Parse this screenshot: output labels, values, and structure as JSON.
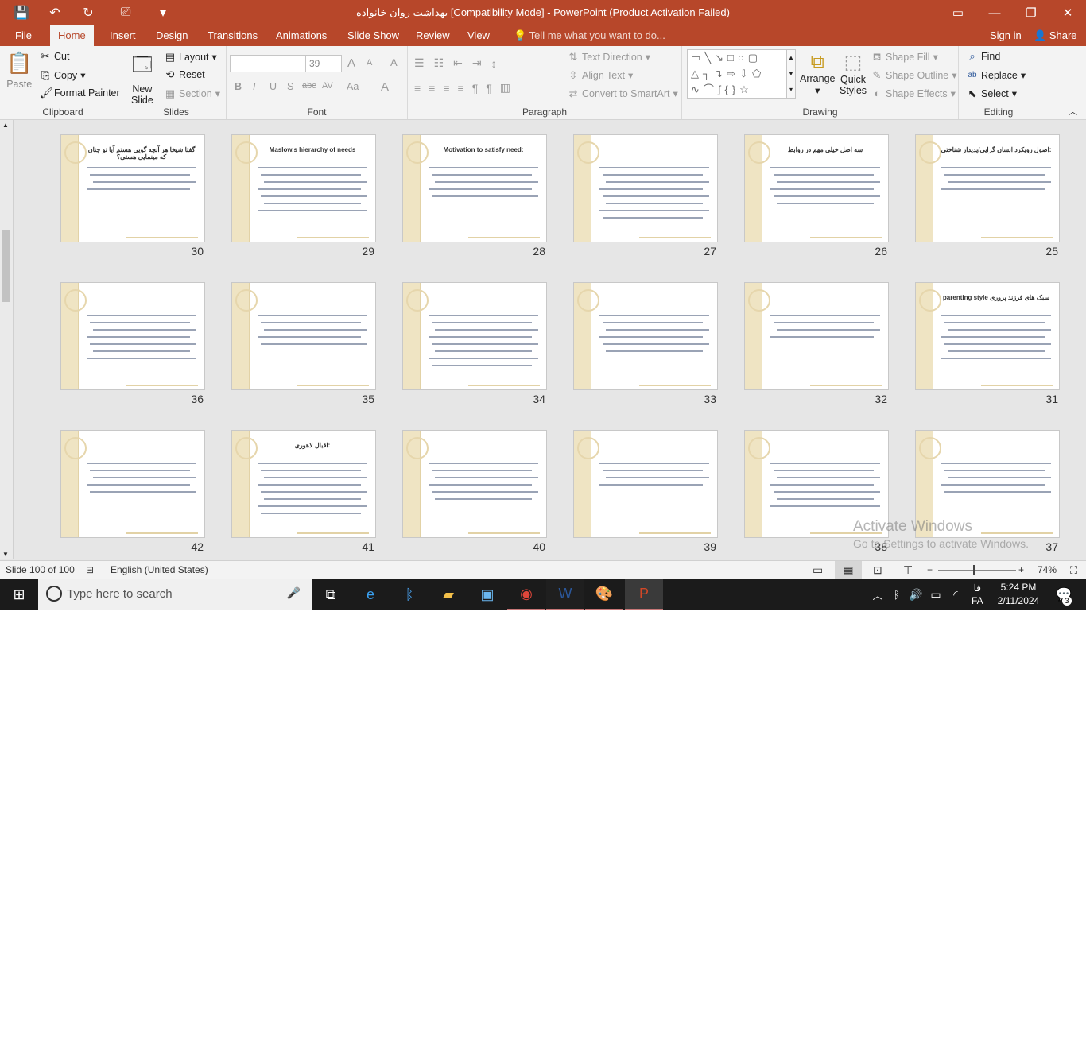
{
  "window": {
    "title": "بهداشت روان خانواده [Compatibility Mode] - PowerPoint (Product Activation Failed)",
    "controls": {
      "ribbon_display": "▭",
      "minimize": "—",
      "restore": "❐",
      "close": "✕"
    }
  },
  "qat": {
    "save": "💾",
    "undo": "↶",
    "redo": "↻",
    "present": "⎚",
    "customize": "▾"
  },
  "tabs": [
    "File",
    "Home",
    "Insert",
    "Design",
    "Transitions",
    "Animations",
    "Slide Show",
    "Review",
    "View"
  ],
  "tell_me": "Tell me what you want to do...",
  "sign_in": "Sign in",
  "share": "Share",
  "ribbon": {
    "clipboard": {
      "paste": "Paste",
      "cut": "Cut",
      "copy": "Copy",
      "format_painter": "Format Painter",
      "label": "Clipboard"
    },
    "slides": {
      "new_slide_1": "New",
      "new_slide_2": "Slide",
      "layout": "Layout",
      "reset": "Reset",
      "section": "Section",
      "label": "Slides"
    },
    "font": {
      "size": "39",
      "label": "Font",
      "bold": "B",
      "italic": "I",
      "underline": "U",
      "shadow": "S",
      "strike": "abc",
      "spacing": "AV",
      "case": "Aa",
      "color": "A",
      "grow": "A",
      "shrink": "A",
      "clear": "A"
    },
    "paragraph": {
      "text_direction": "Text Direction",
      "align_text": "Align Text",
      "smartart": "Convert to SmartArt",
      "label": "Paragraph"
    },
    "drawing": {
      "arrange": "Arrange",
      "quick_styles_1": "Quick",
      "quick_styles_2": "Styles",
      "shape_fill": "Shape Fill",
      "shape_outline": "Shape Outline",
      "shape_effects": "Shape Effects",
      "label": "Drawing"
    },
    "editing": {
      "find": "Find",
      "replace": "Replace",
      "select": "Select",
      "label": "Editing"
    }
  },
  "slides": [
    {
      "num": "30",
      "title": "گفتا شیخا هر آنچه گویی هستم آیا تو چنان که مینمایی هستی؟"
    },
    {
      "num": "29",
      "title": "Maslow,s hierarchy of needs"
    },
    {
      "num": "28",
      "title": "Motivation to satisfy need:"
    },
    {
      "num": "27",
      "title": ""
    },
    {
      "num": "26",
      "title": "سه اصل خیلی مهم در روابط"
    },
    {
      "num": "25",
      "title": "اصول رویکرد انسان گرایی/پدیدار شناختی:"
    },
    {
      "num": "36",
      "title": ""
    },
    {
      "num": "35",
      "title": ""
    },
    {
      "num": "34",
      "title": ""
    },
    {
      "num": "33",
      "title": ""
    },
    {
      "num": "32",
      "title": ""
    },
    {
      "num": "31",
      "title": "parenting style سبک های فرزند پروری"
    },
    {
      "num": "42",
      "title": ""
    },
    {
      "num": "41",
      "title": "اقبال لاهوری:"
    },
    {
      "num": "40",
      "title": ""
    },
    {
      "num": "39",
      "title": ""
    },
    {
      "num": "38",
      "title": ""
    },
    {
      "num": "37",
      "title": ""
    }
  ],
  "activate": {
    "line1": "Activate Windows",
    "line2": "Go to Settings to activate Windows."
  },
  "status": {
    "slide_info": "Slide 100 of 100",
    "language": "English (United States)",
    "zoom": "74%",
    "zoom_level": 0.45
  },
  "taskbar": {
    "search_placeholder": "Type here to search",
    "time": "5:24 PM",
    "date": "2/11/2024",
    "lang_1": "فا",
    "lang_2": "FA",
    "notif_count": "3"
  }
}
